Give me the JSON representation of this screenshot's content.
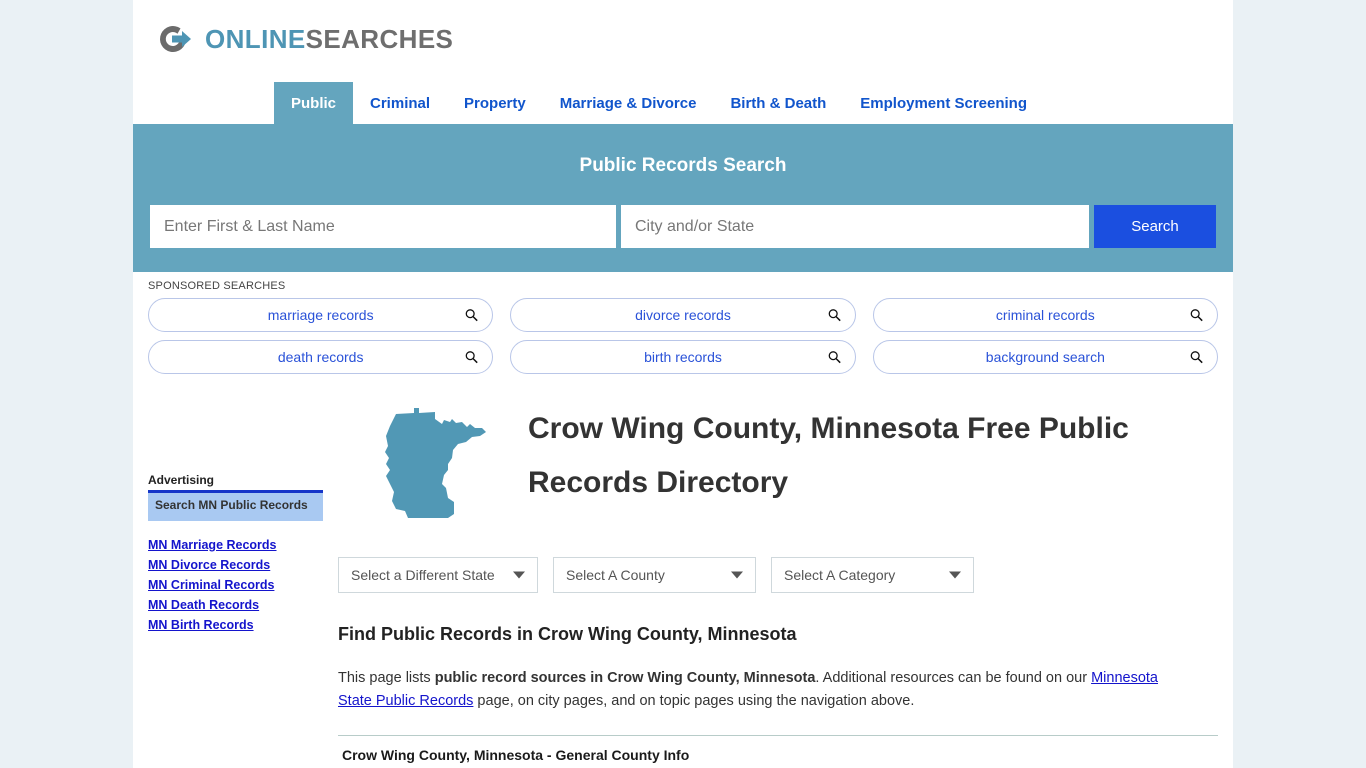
{
  "site": {
    "logo_primary": "ONLINE",
    "logo_secondary": "SEARCHES",
    "logo_icon": "circle-arrow-logo",
    "accent_teal": "#64a5be",
    "accent_blue": "#1b4fe0",
    "link_blue": "#1414cc",
    "page_bg": "#eaf1f5"
  },
  "nav": {
    "items": [
      {
        "label": "Public",
        "active": true
      },
      {
        "label": "Criminal",
        "active": false
      },
      {
        "label": "Property",
        "active": false
      },
      {
        "label": "Marriage & Divorce",
        "active": false
      },
      {
        "label": "Birth & Death",
        "active": false
      },
      {
        "label": "Employment Screening",
        "active": false
      }
    ]
  },
  "hero": {
    "title": "Public Records Search",
    "name_placeholder": "Enter First & Last Name",
    "name_value": "",
    "city_placeholder": "City and/or State",
    "city_value": "",
    "search_button": "Search"
  },
  "sponsored": {
    "label": "SPONSORED SEARCHES",
    "items": [
      "marriage records",
      "divorce records",
      "criminal records",
      "death records",
      "birth records",
      "background search"
    ]
  },
  "sidebar": {
    "advertising_label": "Advertising",
    "ad_box_text": "Search MN Public Records",
    "links": [
      "MN Marriage Records",
      "MN Divorce Records",
      "MN Criminal Records",
      "MN Death Records",
      "MN Birth Records"
    ]
  },
  "main": {
    "state_map_name": "minnesota-state-outline",
    "page_title": "Crow Wing County, Minnesota Free Public Records Directory",
    "selects": {
      "state": "Select a Different State",
      "county": "Select A County",
      "category": "Select A Category"
    },
    "section_heading": "Find Public Records in Crow Wing County, Minnesota",
    "lede_part1": "This page lists ",
    "lede_bold": "public record sources in Crow Wing County, Minnesota",
    "lede_part2": ". Additional resources can be found on our ",
    "lede_link": "Minnesota State Public Records",
    "lede_part3": " page, on city pages, and on topic pages using the navigation above.",
    "table_first_row": "Crow Wing County, Minnesota - General County Info"
  }
}
